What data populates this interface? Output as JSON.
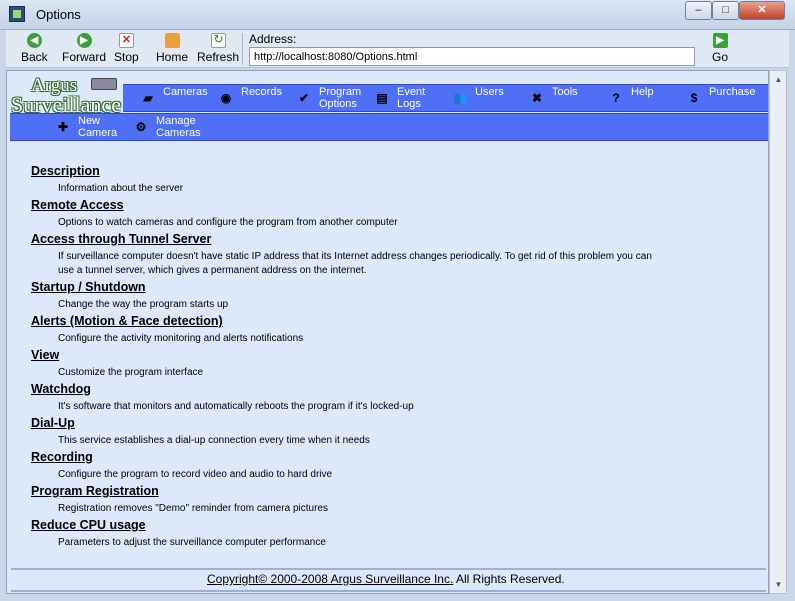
{
  "window": {
    "title": "Options",
    "min": "–",
    "max": "□",
    "close": "✕"
  },
  "toolbar": {
    "back": "Back",
    "forward": "Forward",
    "stop": "Stop",
    "home": "Home",
    "refresh": "Refresh",
    "address_label": "Address:",
    "address_value": "http://localhost:8080/Options.html",
    "go": "Go"
  },
  "logo": {
    "line1": "Argus",
    "line2": "Surveillance"
  },
  "menu": [
    {
      "label": "Cameras",
      "icon": "camera-icon"
    },
    {
      "label": "Records",
      "icon": "disc-icon"
    },
    {
      "label": "Program Options",
      "icon": "checkmark-icon"
    },
    {
      "label": "Event Logs",
      "icon": "document-icon"
    },
    {
      "label": "Users",
      "icon": "users-icon"
    },
    {
      "label": "Tools",
      "icon": "tools-icon"
    },
    {
      "label": "Help",
      "icon": "help-icon"
    },
    {
      "label": "Purchase",
      "icon": "dollar-icon"
    }
  ],
  "submenu": [
    {
      "label": "New Camera",
      "icon": "add-camera-icon"
    },
    {
      "label": "Manage Cameras",
      "icon": "manage-cameras-icon"
    }
  ],
  "options": [
    {
      "title": "Description",
      "desc": "Information about the server"
    },
    {
      "title": "Remote Access",
      "desc": "Options to watch cameras and configure the program from another computer"
    },
    {
      "title": "Access through Tunnel Server",
      "desc": "If surveillance computer doesn't have static IP address that its Internet address changes periodically. To get rid of this problem you can use a tunnel server, which gives a permanent address on the internet."
    },
    {
      "title": "Startup / Shutdown",
      "desc": "Change the way the program starts up"
    },
    {
      "title": "Alerts (Motion & Face detection)",
      "desc": "Configure the activity monitoring and alerts notifications"
    },
    {
      "title": "View",
      "desc": "Customize the program interface"
    },
    {
      "title": "Watchdog",
      "desc": "It's software that monitors and automatically reboots the program if it's locked-up"
    },
    {
      "title": "Dial-Up",
      "desc": "This service establishes a dial-up connection every time when it needs"
    },
    {
      "title": "Recording",
      "desc": "Configure the program to record video and audio to hard drive"
    },
    {
      "title": "Program Registration",
      "desc": "Registration removes \"Demo\" reminder from camera pictures"
    },
    {
      "title": "Reduce CPU usage",
      "desc": "Parameters to adjust the surveillance computer performance"
    }
  ],
  "footer": {
    "copyright_link": "Copyright© 2000-2008 Argus Surveillance Inc.",
    "rights": " All Rights Reserved."
  },
  "colors": {
    "menu_bg": "#4f6ff7",
    "content_bg": "#dde8fb",
    "logo_green": "#2f6a2f"
  }
}
